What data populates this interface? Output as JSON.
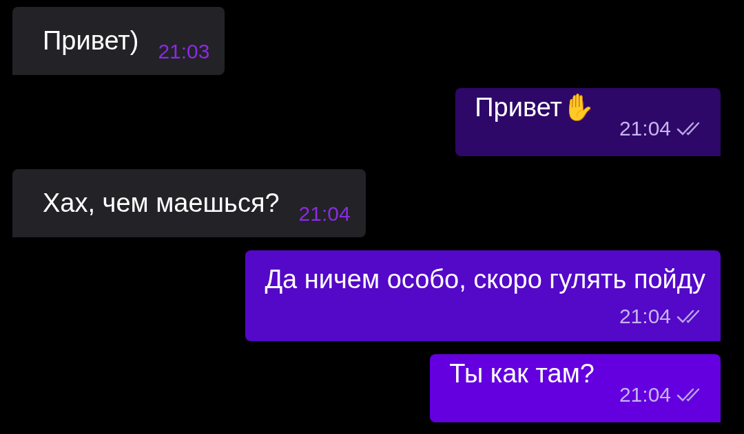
{
  "messages": [
    {
      "kind": "incoming",
      "text": "Привет)",
      "time": "21:03"
    },
    {
      "kind": "outgoing",
      "text": "Привет✋",
      "time": "21:04",
      "read": true,
      "color": "#2e0868"
    },
    {
      "kind": "incoming",
      "text": "Хах, чем маешься?",
      "time": "21:04"
    },
    {
      "kind": "outgoing",
      "text": "Да ничем особо, скоро гулять пойду",
      "time": "21:04",
      "read": true,
      "color": "#5408c8"
    },
    {
      "kind": "outgoing",
      "text": "Ты как там?",
      "time": "21:04",
      "read": true,
      "color": "#6400e0"
    }
  ]
}
